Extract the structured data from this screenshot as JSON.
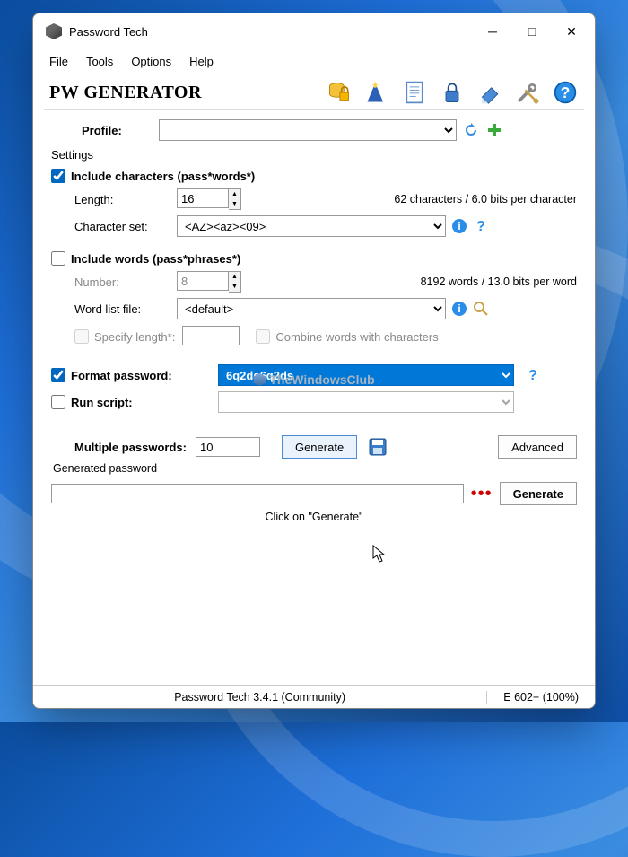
{
  "title": "Password Tech",
  "menu": [
    "File",
    "Tools",
    "Options",
    "Help"
  ],
  "header": "PW GENERATOR",
  "profile_label": "Profile:",
  "settings_label": "Settings",
  "include_chars": {
    "label": "Include characters (pass*words*)",
    "checked": true,
    "length_label": "Length:",
    "length_value": "16",
    "info": "62 characters / 6.0 bits per character",
    "charset_label": "Character set:",
    "charset_value": "<AZ><az><09>"
  },
  "include_words": {
    "label": "Include words (pass*phrases*)",
    "checked": false,
    "number_label": "Number:",
    "number_value": "8",
    "info": "8192 words / 13.0 bits per word",
    "wordlist_label": "Word list file:",
    "wordlist_value": "<default>",
    "specify_label": "Specify length*:",
    "combine_label": "Combine words with characters"
  },
  "watermark": "TheWindowsClub",
  "format_pw": {
    "label": "Format password:",
    "checked": true,
    "value": "6q2ds6q2ds"
  },
  "run_script": {
    "label": "Run script:",
    "checked": false
  },
  "multiple": {
    "label": "Multiple passwords:",
    "value": "10",
    "generate": "Generate",
    "advanced": "Advanced"
  },
  "generated": {
    "legend": "Generated password",
    "generate": "Generate",
    "hint": "Click on \"Generate\""
  },
  "status": {
    "mid": "Password Tech 3.4.1 (Community)",
    "right": "E  602+ (100%)"
  }
}
